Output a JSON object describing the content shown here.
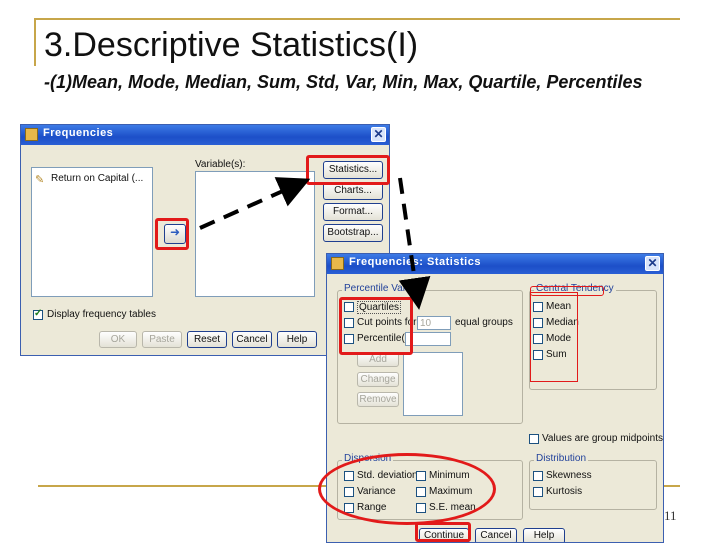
{
  "slide": {
    "title": "3.Descriptive Statistics(I)",
    "subtitle": "-(1)Mean, Mode, Median, Sum,  Std, Var, Min, Max, Quartile, Percentiles",
    "page_number": "11"
  },
  "frequencies_dialog": {
    "title": "Frequencies",
    "source_list_item": "Return on Capital (...",
    "variables_label": "Variable(s):",
    "side_buttons": [
      "Statistics...",
      "Charts...",
      "Format...",
      "Bootstrap..."
    ],
    "display_tables_label": "Display frequency tables",
    "bottom_buttons": [
      "OK",
      "Paste",
      "Reset",
      "Cancel",
      "Help"
    ]
  },
  "statistics_dialog": {
    "title": "Frequencies: Statistics",
    "percentile_group": "Percentile Values",
    "quartiles": "Quartiles",
    "cut_points_label": "Cut points for:",
    "cut_points_value": "10",
    "equal_groups_label": "equal groups",
    "percentiles_label": "Percentile(s):",
    "add_button": "Add",
    "change_button": "Change",
    "remove_button": "Remove",
    "central_tendency_group": "Central Tendency",
    "central_items": [
      "Mean",
      "Median",
      "Mode",
      "Sum"
    ],
    "group_midpoints_label": "Values are group midpoints",
    "dispersion_group": "Dispersion",
    "dispersion_left": [
      "Std. deviation",
      "Variance",
      "Range"
    ],
    "dispersion_right": [
      "Minimum",
      "Maximum",
      "S.E. mean"
    ],
    "distribution_group": "Distribution",
    "distribution_items": [
      "Skewness",
      "Kurtosis"
    ],
    "bottom_buttons": [
      "Continue",
      "Cancel",
      "Help"
    ]
  },
  "colors": {
    "accent_gold": "#c7a64a",
    "annotation_red": "#e21a1a",
    "titlebar_blue": "#1c4fc8"
  }
}
